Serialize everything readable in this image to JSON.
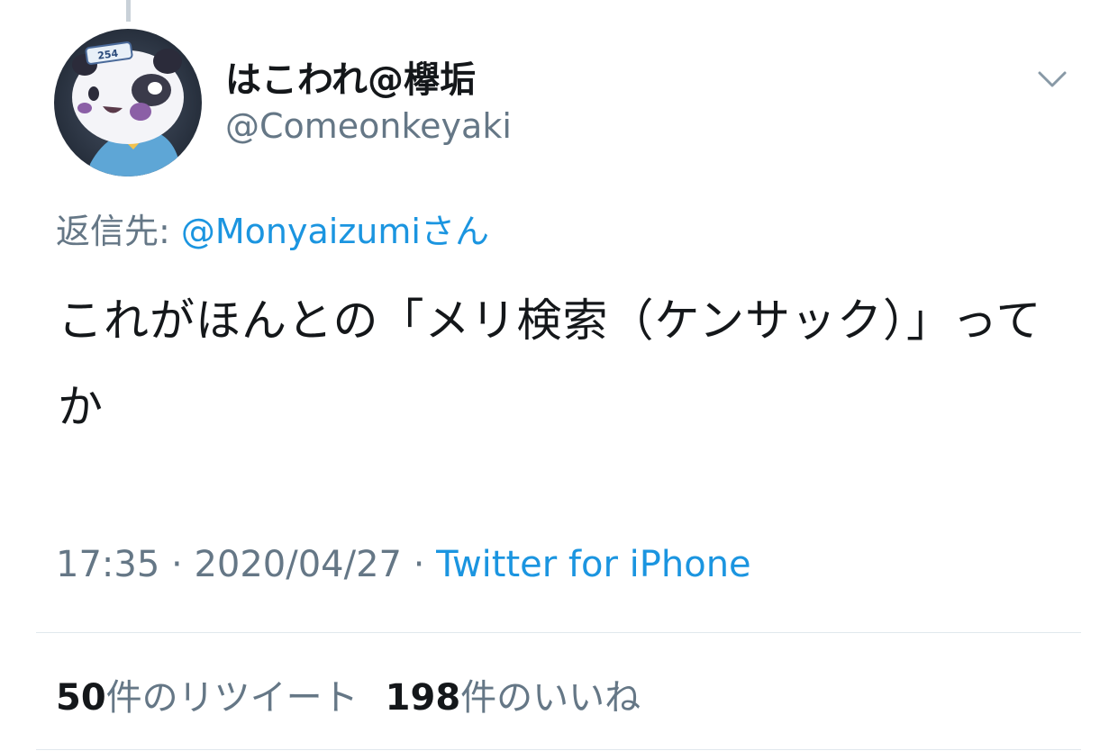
{
  "tweet": {
    "author": {
      "display_name": "はこわれ@欅垢",
      "handle": "@Comeonkeyaki",
      "avatar_badge": "254"
    },
    "reply": {
      "prefix": "返信先: ",
      "mention": "@Monyaizumi",
      "suffix": "さん"
    },
    "text": "これがほんとの「メリ検索（ケンサック）」ってか",
    "time": "17:35",
    "separator": " · ",
    "date": "2020/04/27",
    "source": "Twitter for iPhone",
    "retweets": {
      "count": "50",
      "label": "件のリツイート"
    },
    "likes": {
      "count": "198",
      "label": "件のいいね"
    },
    "icons": {
      "more": "chevron-down-icon",
      "avatar": "avatar-image"
    },
    "colors": {
      "link": "#1b95e0",
      "secondary": "#657786",
      "primary": "#14171a",
      "divider": "#e1e8ed"
    }
  }
}
